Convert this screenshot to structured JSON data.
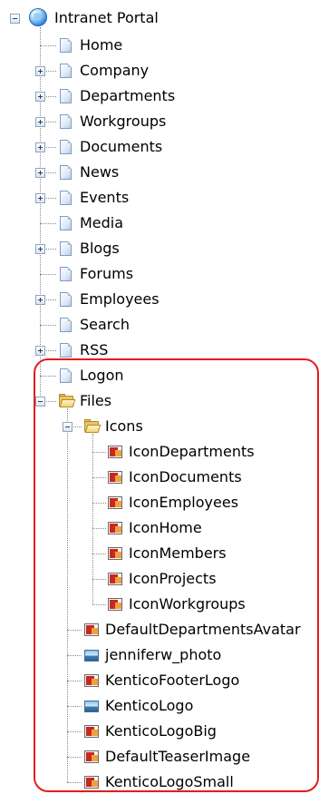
{
  "tree": {
    "root": {
      "label": "Intranet Portal",
      "icon": "globe-icon",
      "expanded": true
    },
    "items": [
      {
        "label": "Home",
        "icon": "page-icon"
      },
      {
        "label": "Company",
        "icon": "page-icon",
        "expandable": true
      },
      {
        "label": "Departments",
        "icon": "page-icon",
        "expandable": true
      },
      {
        "label": "Workgroups",
        "icon": "page-icon",
        "expandable": true
      },
      {
        "label": "Documents",
        "icon": "page-icon",
        "expandable": true
      },
      {
        "label": "News",
        "icon": "page-icon",
        "expandable": true
      },
      {
        "label": "Events",
        "icon": "page-icon",
        "expandable": true
      },
      {
        "label": "Media",
        "icon": "page-icon"
      },
      {
        "label": "Blogs",
        "icon": "page-icon",
        "expandable": true
      },
      {
        "label": "Forums",
        "icon": "page-icon"
      },
      {
        "label": "Employees",
        "icon": "page-icon",
        "expandable": true
      },
      {
        "label": "Search",
        "icon": "page-icon"
      },
      {
        "label": "RSS",
        "icon": "page-icon",
        "expandable": true
      },
      {
        "label": "Logon",
        "icon": "page-icon"
      },
      {
        "label": "Files",
        "icon": "folder-icon",
        "expanded": true
      }
    ],
    "files": {
      "icons_folder": {
        "label": "Icons",
        "icon": "folder-icon",
        "expanded": true,
        "items": [
          {
            "label": "IconDepartments",
            "icon": "image-file-icon"
          },
          {
            "label": "IconDocuments",
            "icon": "image-file-icon"
          },
          {
            "label": "IconEmployees",
            "icon": "image-file-icon"
          },
          {
            "label": "IconHome",
            "icon": "image-file-icon"
          },
          {
            "label": "IconMembers",
            "icon": "image-file-icon"
          },
          {
            "label": "IconProjects",
            "icon": "image-file-icon"
          },
          {
            "label": "IconWorkgroups",
            "icon": "image-file-icon"
          }
        ]
      },
      "items": [
        {
          "label": "DefaultDepartmentsAvatar",
          "icon": "image-file-icon"
        },
        {
          "label": "jenniferw_photo",
          "icon": "photo-icon"
        },
        {
          "label": "KenticoFooterLogo",
          "icon": "image-file-icon"
        },
        {
          "label": "KenticoLogo",
          "icon": "photo-icon"
        },
        {
          "label": "KenticoLogoBig",
          "icon": "image-file-icon"
        },
        {
          "label": "DefaultTeaserImage",
          "icon": "image-file-icon"
        },
        {
          "label": "KenticoLogoSmall",
          "icon": "image-file-icon"
        }
      ]
    }
  },
  "colors": {
    "highlight": "#e41c1c",
    "connector": "#8a8a8a",
    "text": "#000000"
  }
}
